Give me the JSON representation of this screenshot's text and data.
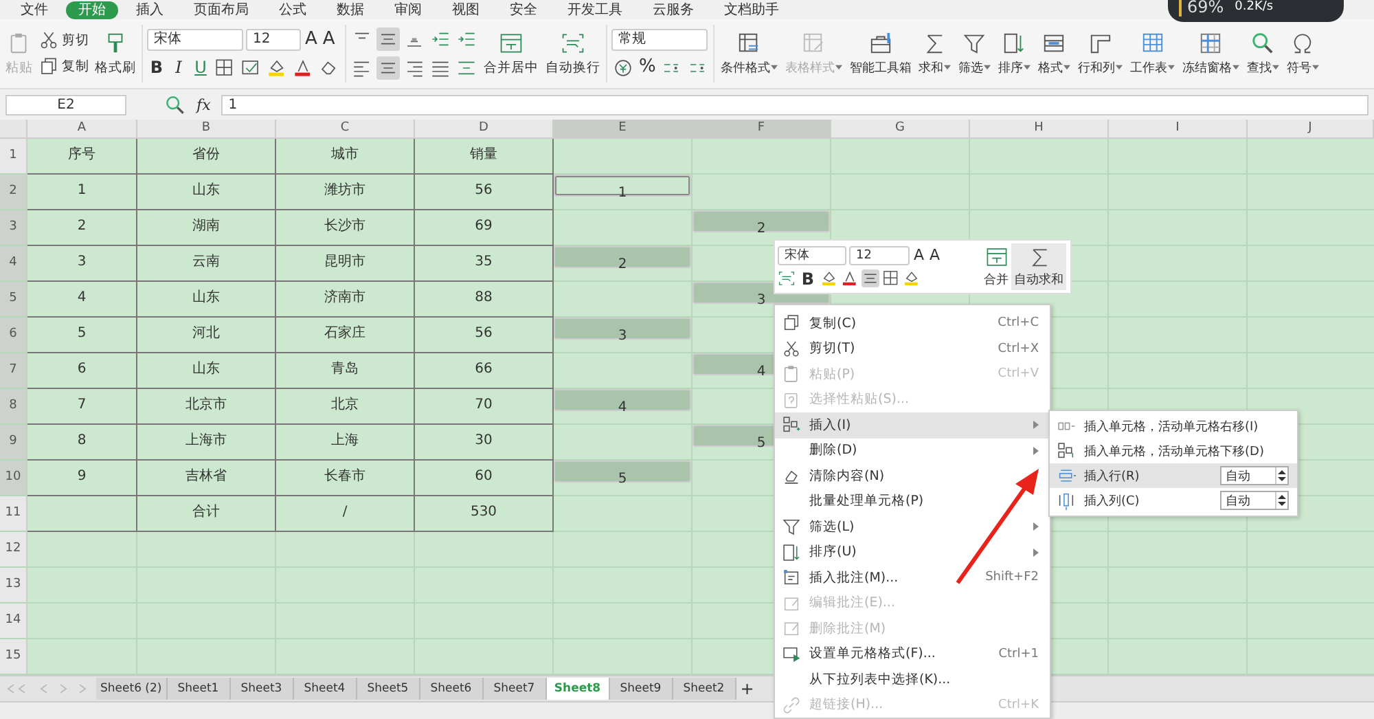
{
  "menu_tabs": [
    {
      "label": "文件",
      "selected": false
    },
    {
      "label": "开始",
      "selected": true
    },
    {
      "label": "插入",
      "selected": false
    },
    {
      "label": "页面布局",
      "selected": false
    },
    {
      "label": "公式",
      "selected": false
    },
    {
      "label": "数据",
      "selected": false
    },
    {
      "label": "审阅",
      "selected": false
    },
    {
      "label": "视图",
      "selected": false
    },
    {
      "label": "安全",
      "selected": false
    },
    {
      "label": "开发工具",
      "selected": false
    },
    {
      "label": "云服务",
      "selected": false
    },
    {
      "label": "文档助手",
      "selected": false
    }
  ],
  "speed_widget": {
    "percent": "69%",
    "rate": "0.2K/s"
  },
  "ribbon": {
    "paste": {
      "label": "粘贴",
      "disabled": true
    },
    "cut": "剪切",
    "copy": "复制",
    "format_painter": "格式刷",
    "font": "宋体",
    "font_size": "12",
    "grow_shrink": [
      "A",
      "A"
    ],
    "styles": [
      "B",
      "I",
      "U"
    ],
    "merge": "合并居中",
    "wrap": "自动换行",
    "number_format": "常规",
    "percent": "%",
    "tools": [
      {
        "label": "条件格式",
        "disabled": false,
        "dropdown": true
      },
      {
        "label": "表格样式",
        "disabled": true,
        "dropdown": true
      },
      {
        "label": "智能工具箱",
        "disabled": false,
        "dropdown": false
      },
      {
        "label": "求和",
        "disabled": false,
        "dropdown": true
      },
      {
        "label": "筛选",
        "disabled": false,
        "dropdown": true
      },
      {
        "label": "排序",
        "disabled": false,
        "dropdown": true
      },
      {
        "label": "格式",
        "disabled": false,
        "dropdown": true
      },
      {
        "label": "行和列",
        "disabled": false,
        "dropdown": true
      },
      {
        "label": "工作表",
        "disabled": false,
        "dropdown": true
      },
      {
        "label": "冻结窗格",
        "disabled": false,
        "dropdown": true
      },
      {
        "label": "查找",
        "disabled": false,
        "dropdown": true
      },
      {
        "label": "符号",
        "disabled": false,
        "dropdown": true
      }
    ]
  },
  "formula_bar": {
    "name_box": "E2",
    "fx": "fx",
    "value": "1"
  },
  "columns": [
    {
      "label": "A",
      "selected": false
    },
    {
      "label": "B",
      "selected": false
    },
    {
      "label": "C",
      "selected": false
    },
    {
      "label": "D",
      "selected": false
    },
    {
      "label": "E",
      "selected": true
    },
    {
      "label": "F",
      "selected": true
    },
    {
      "label": "G",
      "selected": false
    },
    {
      "label": "H",
      "selected": false
    },
    {
      "label": "I",
      "selected": false
    },
    {
      "label": "J",
      "selected": false
    }
  ],
  "rows": [
    {
      "header": "1",
      "selected": false,
      "cells": [
        "序号",
        "省份",
        "城市",
        "销量",
        null,
        null
      ]
    },
    {
      "header": "2",
      "selected": true,
      "cells": [
        "1",
        "山东",
        "潍坊市",
        "56",
        {
          "value": "1",
          "selected": true,
          "active": true
        },
        null
      ]
    },
    {
      "header": "3",
      "selected": true,
      "cells": [
        "2",
        "湖南",
        "长沙市",
        "69",
        null,
        {
          "value": "2",
          "selected": true,
          "active": false
        }
      ]
    },
    {
      "header": "4",
      "selected": true,
      "cells": [
        "3",
        "云南",
        "昆明市",
        "35",
        {
          "value": "2",
          "selected": true,
          "active": false
        },
        null
      ]
    },
    {
      "header": "5",
      "selected": true,
      "cells": [
        "4",
        "山东",
        "济南市",
        "88",
        null,
        {
          "value": "3",
          "selected": true,
          "active": false
        }
      ]
    },
    {
      "header": "6",
      "selected": true,
      "cells": [
        "5",
        "河北",
        "石家庄",
        "56",
        {
          "value": "3",
          "selected": true,
          "active": false
        },
        null
      ]
    },
    {
      "header": "7",
      "selected": true,
      "cells": [
        "6",
        "山东",
        "青岛",
        "66",
        null,
        {
          "value": "4",
          "selected": true,
          "active": false
        }
      ]
    },
    {
      "header": "8",
      "selected": true,
      "cells": [
        "7",
        "北京市",
        "北京",
        "70",
        {
          "value": "4",
          "selected": true,
          "active": false
        },
        null
      ]
    },
    {
      "header": "9",
      "selected": true,
      "cells": [
        "8",
        "上海市",
        "上海",
        "30",
        null,
        {
          "value": "5",
          "selected": true,
          "active": false
        }
      ]
    },
    {
      "header": "10",
      "selected": true,
      "cells": [
        "9",
        "吉林省",
        "长春市",
        "60",
        {
          "value": "5",
          "selected": true,
          "active": false
        },
        null
      ]
    },
    {
      "header": "11",
      "selected": false,
      "cells": [
        null,
        "合计",
        "/",
        "530",
        null,
        null
      ]
    },
    {
      "header": "12",
      "selected": false,
      "cells": []
    },
    {
      "header": "13",
      "selected": false,
      "cells": []
    },
    {
      "header": "14",
      "selected": false,
      "cells": []
    },
    {
      "header": "15",
      "selected": false,
      "cells": []
    }
  ],
  "sheet_tabs": [
    {
      "label": "Sheet6 (2)",
      "selected": false
    },
    {
      "label": "Sheet1",
      "selected": false
    },
    {
      "label": "Sheet3",
      "selected": false
    },
    {
      "label": "Sheet4",
      "selected": false
    },
    {
      "label": "Sheet5",
      "selected": false
    },
    {
      "label": "Sheet6",
      "selected": false
    },
    {
      "label": "Sheet7",
      "selected": false
    },
    {
      "label": "Sheet8",
      "selected": true
    },
    {
      "label": "Sheet9",
      "selected": false
    },
    {
      "label": "Sheet2",
      "selected": false
    }
  ],
  "add_sheet": "+",
  "mini_toolbar": {
    "font": "宋体",
    "font_size": "12",
    "grow_shrink": [
      "A",
      "A"
    ],
    "bold": "B",
    "merge": "合并",
    "autosum": "自动求和"
  },
  "context_menu": [
    {
      "kind": "item",
      "label": "复制(C)",
      "shortcut": "Ctrl+C",
      "disabled": false,
      "selected": false
    },
    {
      "kind": "item",
      "label": "剪切(T)",
      "shortcut": "Ctrl+X",
      "disabled": false,
      "selected": false
    },
    {
      "kind": "item",
      "label": "粘贴(P)",
      "shortcut": "Ctrl+V",
      "disabled": true,
      "selected": false
    },
    {
      "kind": "item",
      "label": "选择性粘贴(S)...",
      "disabled": true,
      "selected": false
    },
    {
      "kind": "submenu",
      "label": "插入(I)",
      "disabled": false,
      "selected": true
    },
    {
      "kind": "submenu",
      "label": "删除(D)",
      "disabled": false,
      "selected": false
    },
    {
      "kind": "item",
      "label": "清除内容(N)",
      "disabled": false,
      "selected": false
    },
    {
      "kind": "item",
      "label": "批量处理单元格(P)",
      "disabled": false,
      "selected": false
    },
    {
      "kind": "submenu",
      "label": "筛选(L)",
      "disabled": false,
      "selected": false
    },
    {
      "kind": "submenu",
      "label": "排序(U)",
      "disabled": false,
      "selected": false
    },
    {
      "kind": "item",
      "label": "插入批注(M)...",
      "shortcut": "Shift+F2",
      "disabled": false,
      "selected": false
    },
    {
      "kind": "item",
      "label": "编辑批注(E)...",
      "disabled": true,
      "selected": false
    },
    {
      "kind": "item",
      "label": "删除批注(M)",
      "disabled": true,
      "selected": false
    },
    {
      "kind": "item",
      "label": "设置单元格格式(F)...",
      "shortcut": "Ctrl+1",
      "disabled": false,
      "selected": false
    },
    {
      "kind": "item",
      "label": "从下拉列表中选择(K)...",
      "disabled": false,
      "selected": false
    },
    {
      "kind": "item",
      "label": "超链接(H)...",
      "shortcut": "Ctrl+K",
      "disabled": true,
      "selected": false
    }
  ],
  "submenu": [
    {
      "kind": "item",
      "label": "插入单元格，活动单元格右移(I)",
      "selected": false
    },
    {
      "kind": "item",
      "label": "插入单元格，活动单元格下移(D)",
      "selected": false
    },
    {
      "kind": "spin",
      "label": "插入行(R)",
      "value": "自动",
      "selected": true
    },
    {
      "kind": "spin",
      "label": "插入列(C)",
      "value": "自动",
      "selected": false
    }
  ]
}
